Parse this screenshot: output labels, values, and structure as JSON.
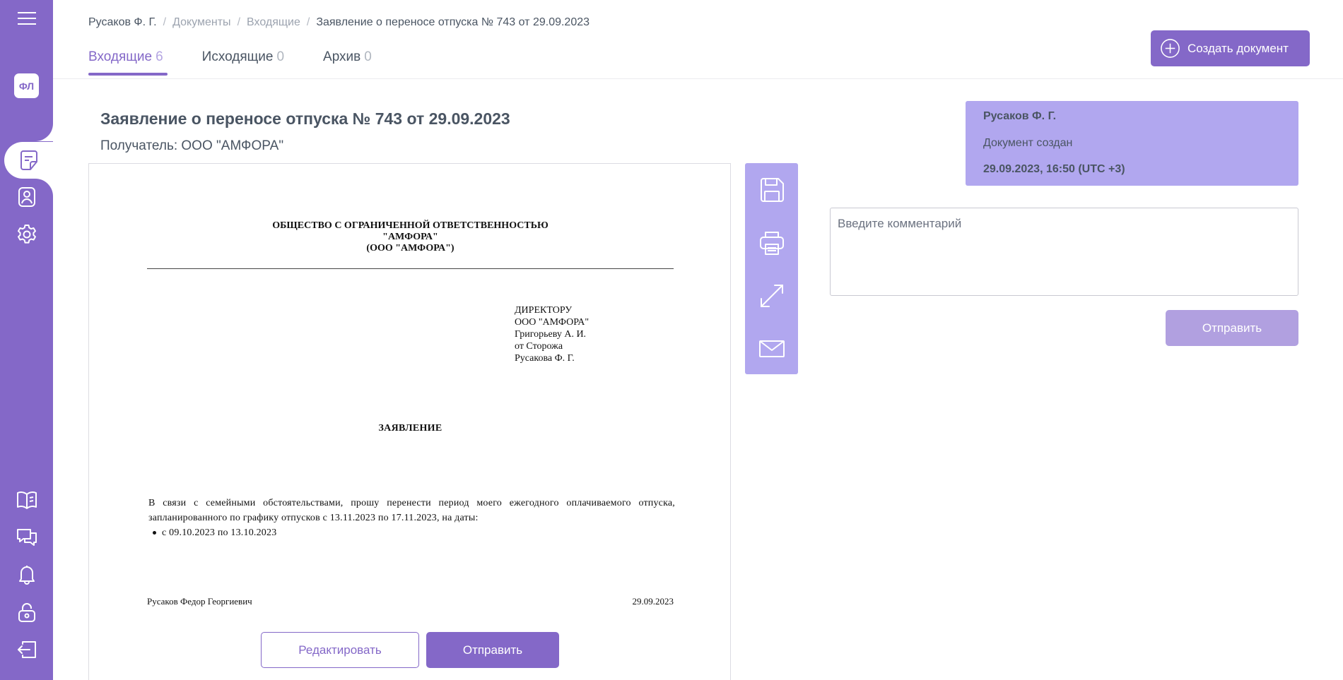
{
  "sidebar": {
    "avatar_initials": "ФЛ",
    "icons": [
      "menu-icon",
      "documents-icon",
      "profile-icon",
      "settings-icon",
      "book-icon",
      "support-chat-icon",
      "notifications-icon",
      "lock-icon",
      "logout-icon"
    ]
  },
  "breadcrumb": {
    "user": "Русаков Ф. Г.",
    "documents": "Документы",
    "incoming": "Входящие",
    "current": "Заявление о переносе отпуска № 743 от 29.09.2023",
    "separator": "/"
  },
  "tabs": [
    {
      "label": "Входящие",
      "count": "6",
      "active": true
    },
    {
      "label": "Исходящие",
      "count": "0",
      "active": false
    },
    {
      "label": "Архив",
      "count": "0",
      "active": false
    }
  ],
  "create_button": {
    "label": "Создать документ"
  },
  "document": {
    "title": "Заявление о переносе отпуска № 743 от 29.09.2023",
    "recipient": "Получатель: ООО \"АМФОРА\"",
    "org_line1": "ОБЩЕСТВО С ОГРАНИЧЕННОЙ ОТВЕТСТВЕННОСТЬЮ",
    "org_line2": "\"АМФОРА\"",
    "org_line3": "(ООО \"АМФОРА\")",
    "addressee": [
      "ДИРЕКТОРУ",
      "ООО \"АМФОРА\"",
      "Григорьеву А. И.",
      "от Сторожа",
      "Русакова Ф. Г."
    ],
    "statement_title": "ЗАЯВЛЕНИЕ",
    "body": "В связи с семейными обстоятельствами, прошу перенести период моего ежегодного оплачиваемого отпуска, запланированного по графику отпусков с 13.11.2023 по 17.11.2023, на даты:",
    "bullet": "с 09.10.2023 по 13.10.2023",
    "signer": "Русаков Федор Георгиевич",
    "date": "29.09.2023"
  },
  "doc_actions": {
    "edit": "Редактировать",
    "send": "Отправить"
  },
  "toolbar": [
    "save-icon",
    "print-icon",
    "expand-icon",
    "mail-icon"
  ],
  "history": {
    "name": "Русаков Ф. Г.",
    "action": "Документ создан",
    "time": "29.09.2023, 16:50 (UTC +3)"
  },
  "comment": {
    "placeholder": "Введите комментарий",
    "send_label": "Отправить"
  },
  "colors": {
    "accent": "#8468c8",
    "accent_light": "#b1a7ef",
    "text": "#4a5563"
  }
}
